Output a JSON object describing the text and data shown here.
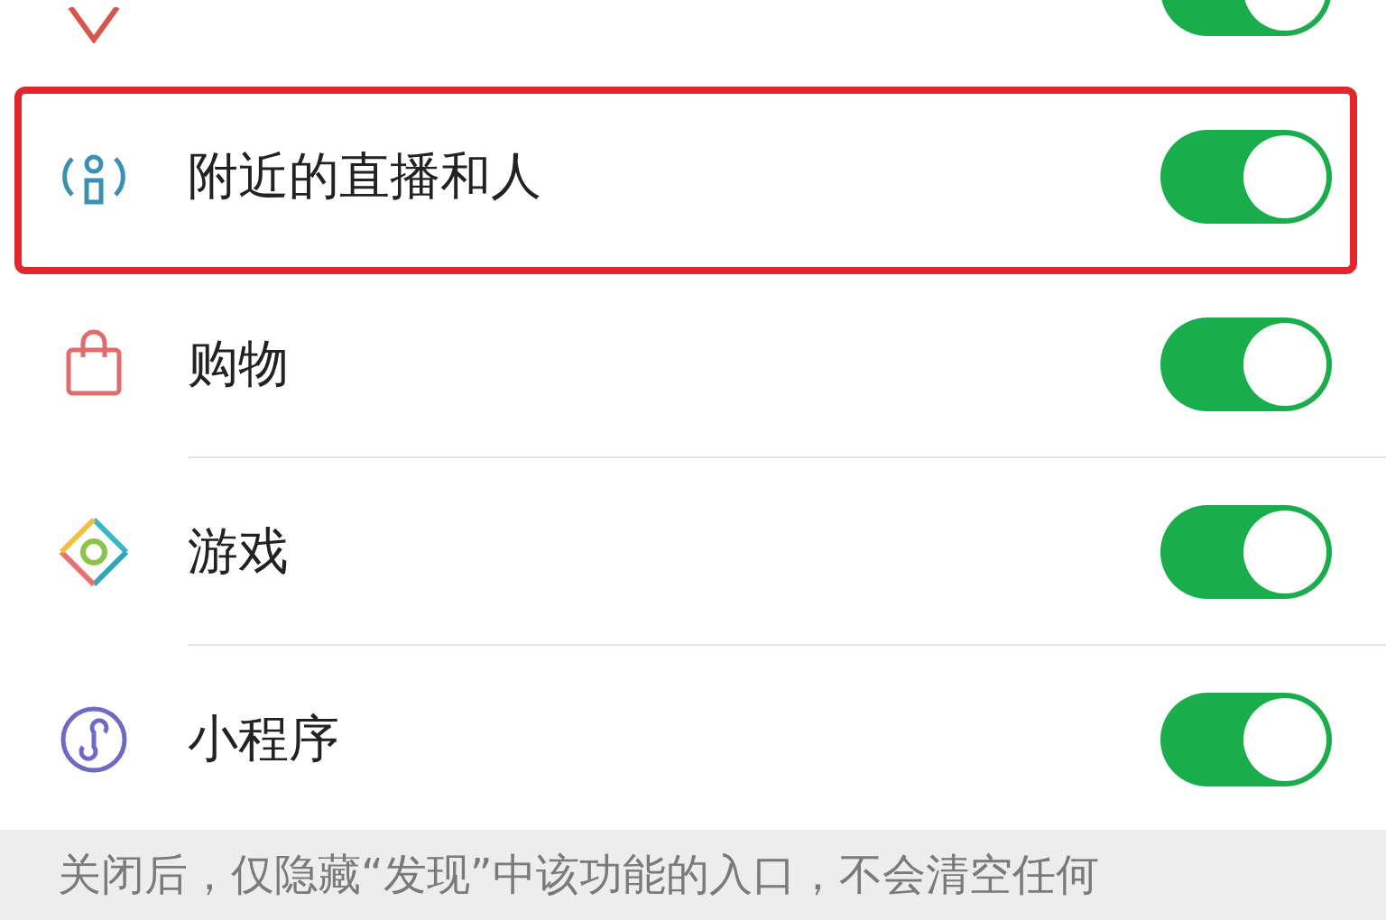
{
  "settings": [
    {
      "on": true,
      "highlighted": false
    },
    {
      "label": "附近的直播和人",
      "on": true,
      "highlighted": true
    },
    {
      "label": "购物",
      "on": true,
      "highlighted": false
    },
    {
      "label": "游戏",
      "on": true,
      "highlighted": false
    },
    {
      "label": "小程序",
      "on": true,
      "highlighted": false
    }
  ],
  "footer_note": "关闭后，仅隐藏“发现”中该功能的入口，不会清空任何"
}
